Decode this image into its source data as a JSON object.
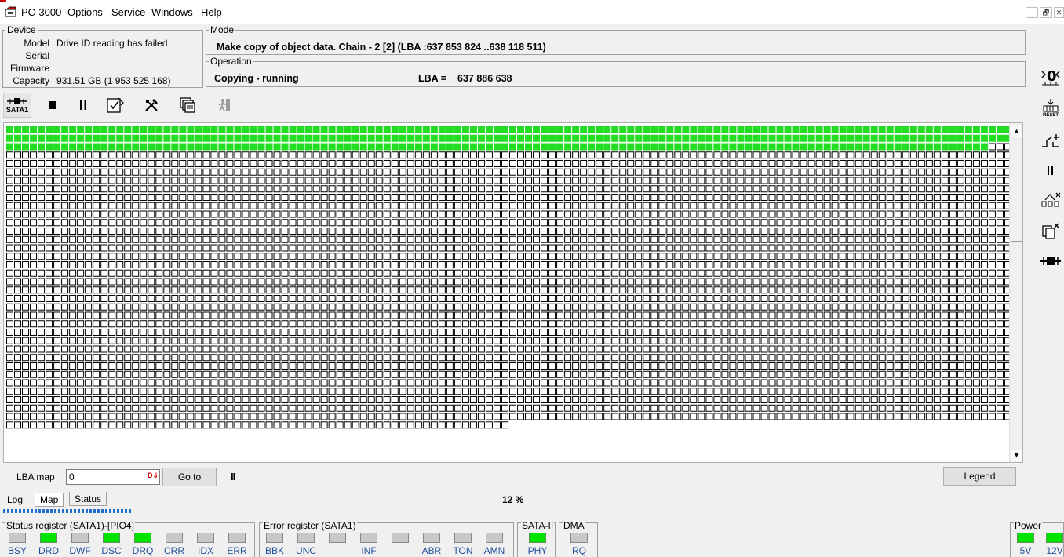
{
  "app": {
    "title": "PC-3000",
    "menu": [
      "Options",
      "Service",
      "Windows",
      "Help"
    ],
    "window_buttons": [
      "_",
      "🗗",
      "✕"
    ]
  },
  "device": {
    "title": "Device",
    "fields": [
      {
        "label": "Model",
        "value": "Drive ID reading has failed"
      },
      {
        "label": "Serial",
        "value": ""
      },
      {
        "label": "Firmware",
        "value": ""
      },
      {
        "label": "Capacity",
        "value": "931.51 GB (1 953 525 168)"
      }
    ]
  },
  "mode": {
    "title": "Mode",
    "text": "Make copy of object data. Chain - 2 [2] (LBA :637 853 824 ..638 118 511)"
  },
  "operation": {
    "title": "Operation",
    "status": "Copying - running",
    "lba_label": "LBA =",
    "lba_value": "637 886 638"
  },
  "toolbar": {
    "port_label": "SATA1",
    "icons": [
      "sata-port-icon",
      "stop-icon",
      "pause-icon",
      "edit-check-icon",
      "tools-icon",
      "copy-windows-icon",
      "exit-icon"
    ]
  },
  "right_toolbar": {
    "reset_label": "RESET",
    "icons": [
      "zero-counter-icon",
      "reset-icon",
      "power-switch-icon",
      "pause-icon",
      "link-disconnect-icon",
      "copy-cancel-icon",
      "connector-icon"
    ]
  },
  "map": {
    "columns": 128,
    "full_rows": 35,
    "last_row_cells": 64,
    "green_full_rows": 2,
    "green_row3_cells": 125,
    "colors": {
      "done": "#22dd22",
      "pending": "#ffffff",
      "border": "#000000"
    }
  },
  "lba_row": {
    "label": "LBA map",
    "input_value": "0",
    "input_icon": "D⇓",
    "goto_label": "Go to",
    "pause_label": "II",
    "legend_label": "Legend"
  },
  "tabs": [
    {
      "label": "Log",
      "active": false
    },
    {
      "label": "Map",
      "active": true
    },
    {
      "label": "Status",
      "active": false
    }
  ],
  "progress": {
    "percent_text": "12 %",
    "percent": 12
  },
  "status_register": {
    "title": "Status register (SATA1)-[PIO4]",
    "bits": [
      {
        "label": "BSY",
        "on": false
      },
      {
        "label": "DRD",
        "on": true
      },
      {
        "label": "DWF",
        "on": false
      },
      {
        "label": "DSC",
        "on": true
      },
      {
        "label": "DRQ",
        "on": true
      },
      {
        "label": "CRR",
        "on": false
      },
      {
        "label": "IDX",
        "on": false
      },
      {
        "label": "ERR",
        "on": false
      }
    ]
  },
  "error_register": {
    "title": "Error register (SATA1)",
    "bits": [
      {
        "label": "BBK",
        "on": false
      },
      {
        "label": "UNC",
        "on": false
      },
      {
        "label": "",
        "on": false
      },
      {
        "label": "INF",
        "on": false
      },
      {
        "label": "",
        "on": false
      },
      {
        "label": "ABR",
        "on": false
      },
      {
        "label": "TON",
        "on": false
      },
      {
        "label": "AMN",
        "on": false
      }
    ]
  },
  "sata": {
    "title": "SATA-II",
    "bits": [
      {
        "label": "PHY",
        "on": true
      }
    ]
  },
  "dma": {
    "title": "DMA",
    "bits": [
      {
        "label": "RQ",
        "on": false
      }
    ]
  },
  "power": {
    "title": "Power",
    "bits": [
      {
        "label": "5V",
        "on": true
      },
      {
        "label": "12V",
        "on": true
      }
    ]
  }
}
